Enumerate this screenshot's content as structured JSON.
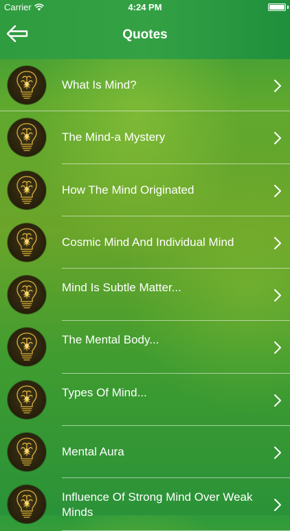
{
  "status": {
    "carrier": "Carrier",
    "time": "4:24 PM"
  },
  "nav": {
    "title": "Quotes",
    "back_icon": "arrow-left-icon"
  },
  "list": {
    "items": [
      {
        "label": "What Is Mind?"
      },
      {
        "label": "The Mind-a Mystery"
      },
      {
        "label": "How The Mind Originated"
      },
      {
        "label": "Cosmic Mind And Individual Mind"
      },
      {
        "label": "Mind Is Subtle Matter..."
      },
      {
        "label": "The Mental Body..."
      },
      {
        "label": "Types Of Mind..."
      },
      {
        "label": "Mental Aura"
      },
      {
        "label": "Influence Of Strong Mind Over Weak Minds"
      }
    ],
    "item_icon": "brain-bulb-icon",
    "accessory_icon": "chevron-right-icon"
  },
  "colors": {
    "header": "#34a144",
    "background": "#6ba52a",
    "text": "#ffffff",
    "bulb": "#e0b43a"
  }
}
